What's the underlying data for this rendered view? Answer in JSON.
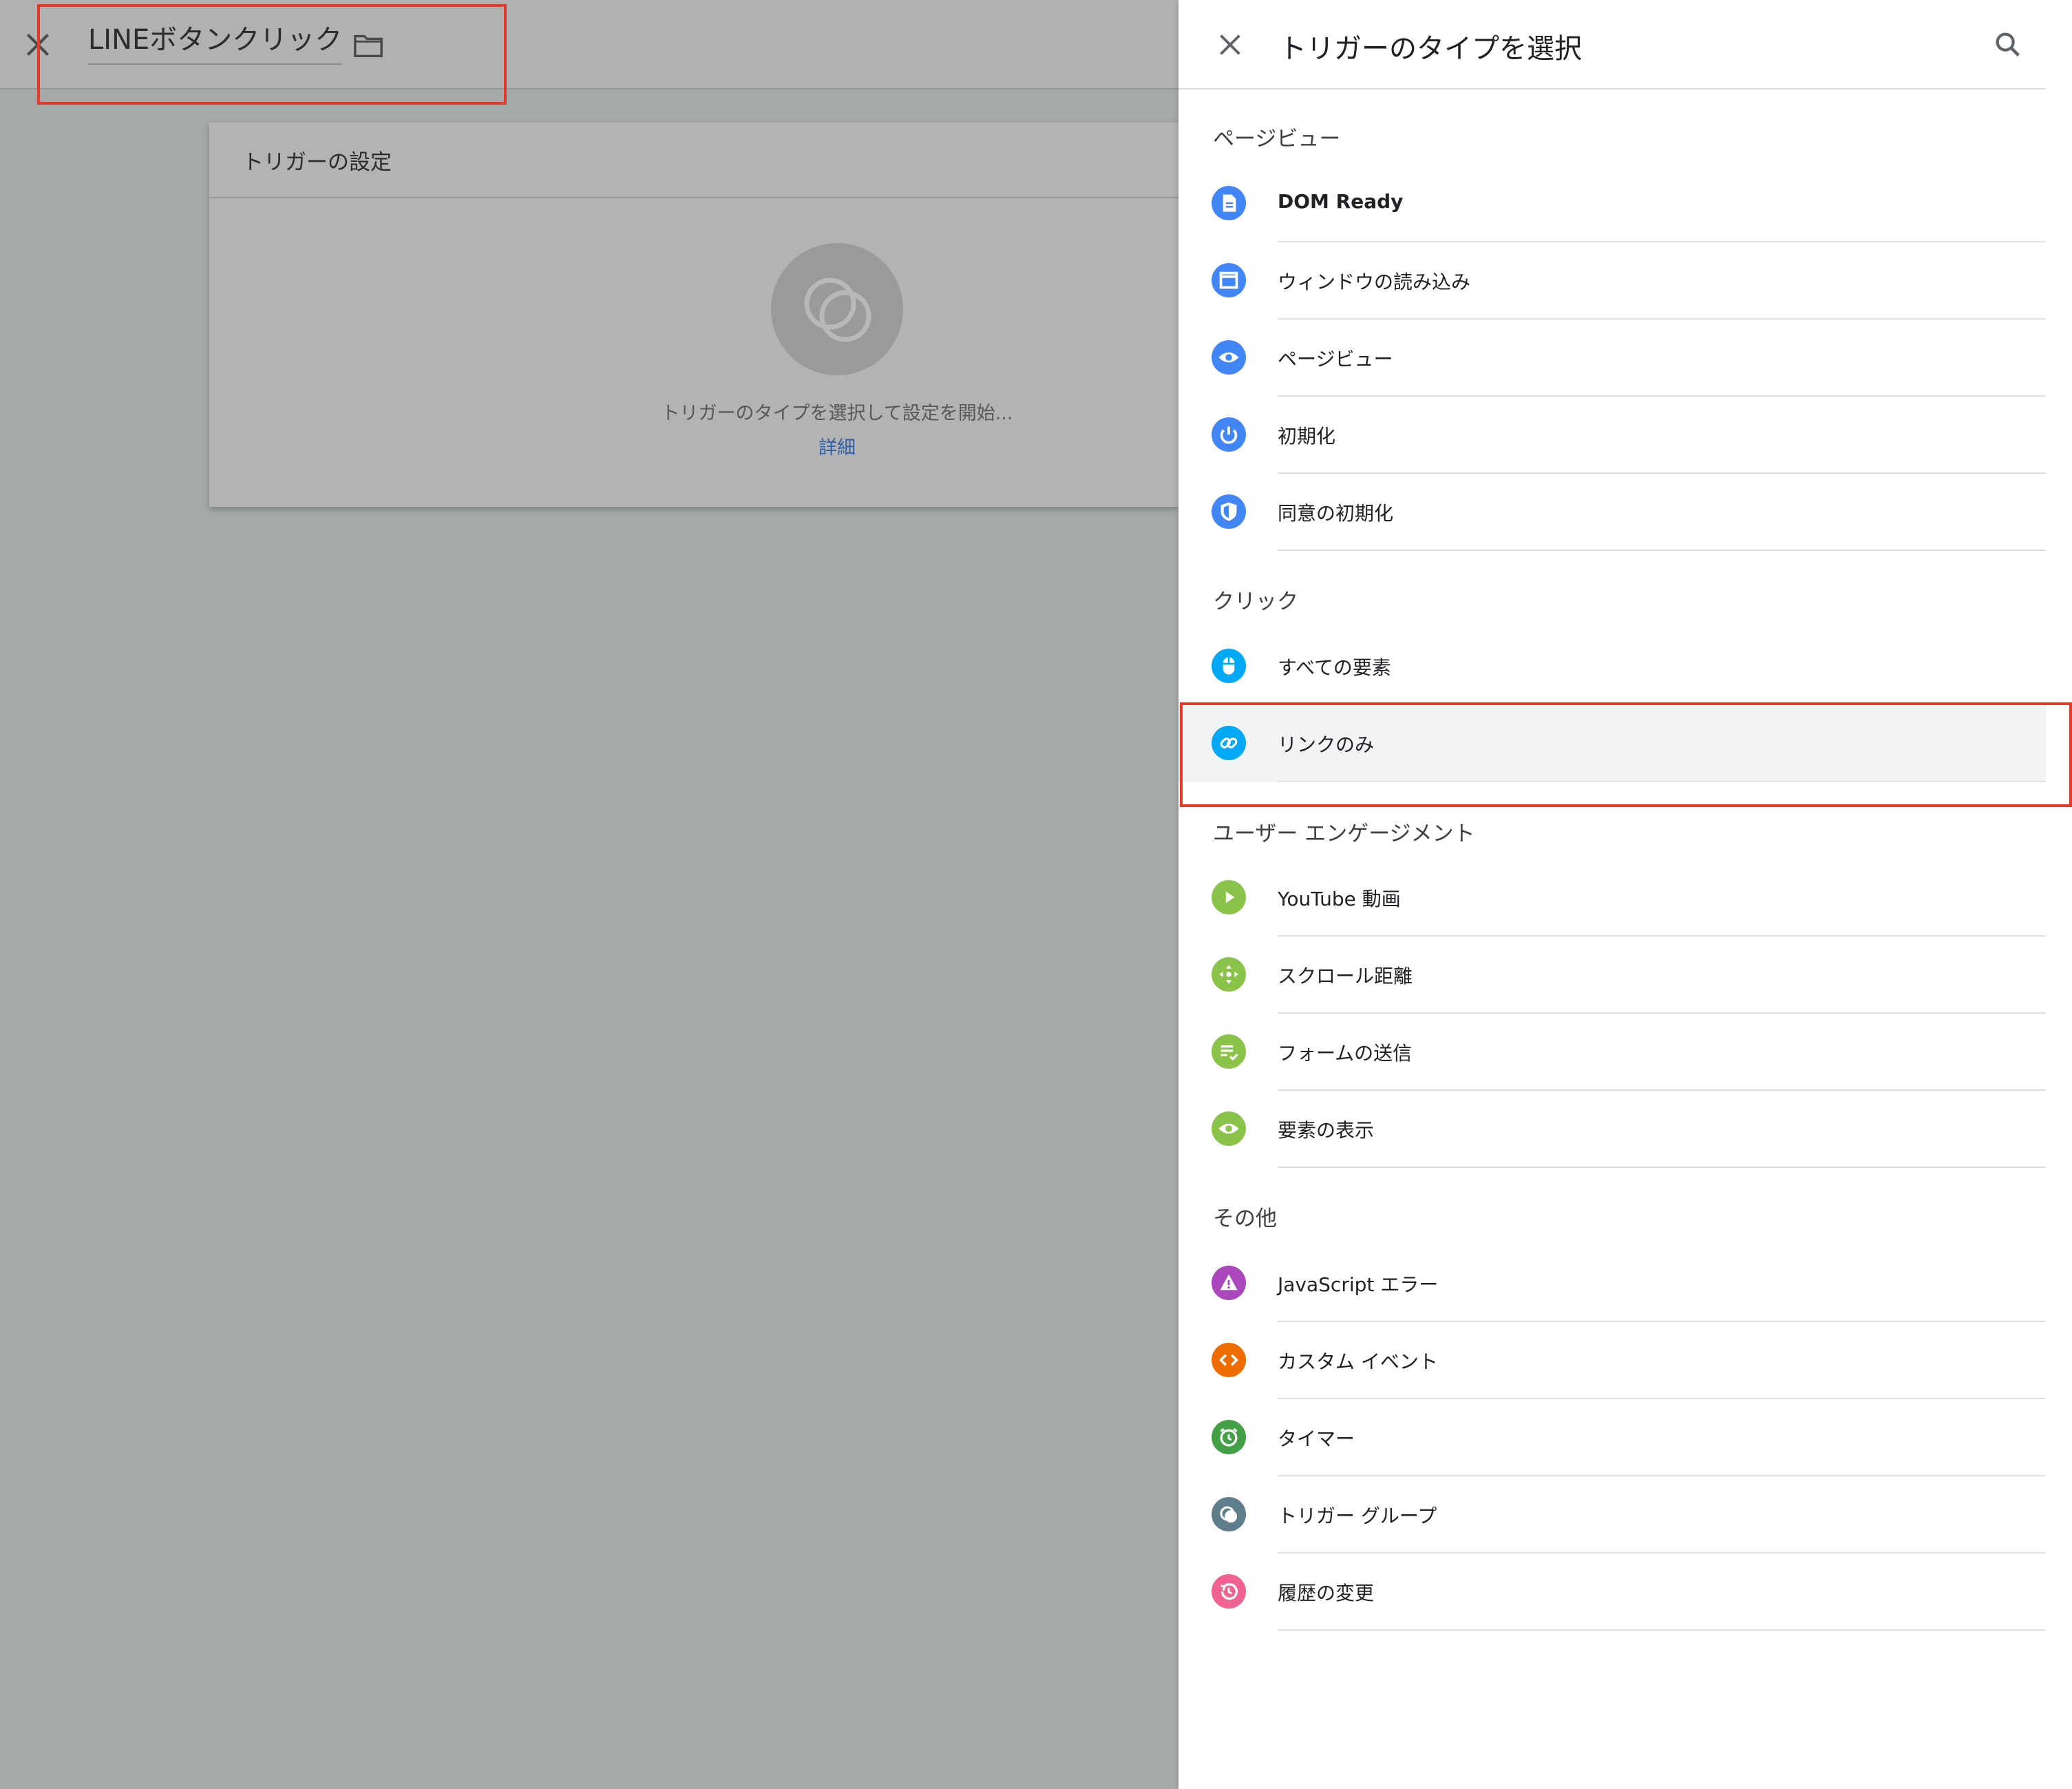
{
  "left": {
    "title": "LINEボタンクリック",
    "card_title": "トリガーの設定",
    "card_message": "トリガーのタイプを選択して設定を開始...",
    "card_link": "詳細"
  },
  "panel": {
    "title": "トリガーのタイプを選択",
    "sections": [
      {
        "label": "ページビュー"
      },
      {
        "label": "クリック"
      },
      {
        "label": "ユーザー エンゲージメント"
      },
      {
        "label": "その他"
      }
    ],
    "items": [
      {
        "label": "DOM Ready",
        "icon": "document-icon",
        "color": "#4285f4"
      },
      {
        "label": "ウィンドウの読み込み",
        "icon": "window-icon",
        "color": "#4285f4"
      },
      {
        "label": "ページビュー",
        "icon": "eye-icon",
        "color": "#4285f4"
      },
      {
        "label": "初期化",
        "icon": "power-icon",
        "color": "#4285f4"
      },
      {
        "label": "同意の初期化",
        "icon": "shield-icon",
        "color": "#4285f4"
      },
      {
        "label": "すべての要素",
        "icon": "mouse-icon",
        "color": "#03a9f4"
      },
      {
        "label": "リンクのみ",
        "icon": "link-icon",
        "color": "#03a9f4"
      },
      {
        "label": "YouTube 動画",
        "icon": "play-icon",
        "color": "#8bc34a"
      },
      {
        "label": "スクロール距離",
        "icon": "scroll-icon",
        "color": "#8bc34a"
      },
      {
        "label": "フォームの送信",
        "icon": "form-icon",
        "color": "#8bc34a"
      },
      {
        "label": "要素の表示",
        "icon": "eye-icon",
        "color": "#8bc34a"
      },
      {
        "label": "JavaScript エラー",
        "icon": "warning-icon",
        "color": "#ab47bc"
      },
      {
        "label": "カスタム イベント",
        "icon": "code-icon",
        "color": "#ef6c00"
      },
      {
        "label": "タイマー",
        "icon": "alarm-icon",
        "color": "#43a047"
      },
      {
        "label": "トリガー グループ",
        "icon": "group-icon",
        "color": "#607d8b"
      },
      {
        "label": "履歴の変更",
        "icon": "history-icon",
        "color": "#f06292"
      }
    ]
  },
  "highlight_color": "#e53a2a"
}
